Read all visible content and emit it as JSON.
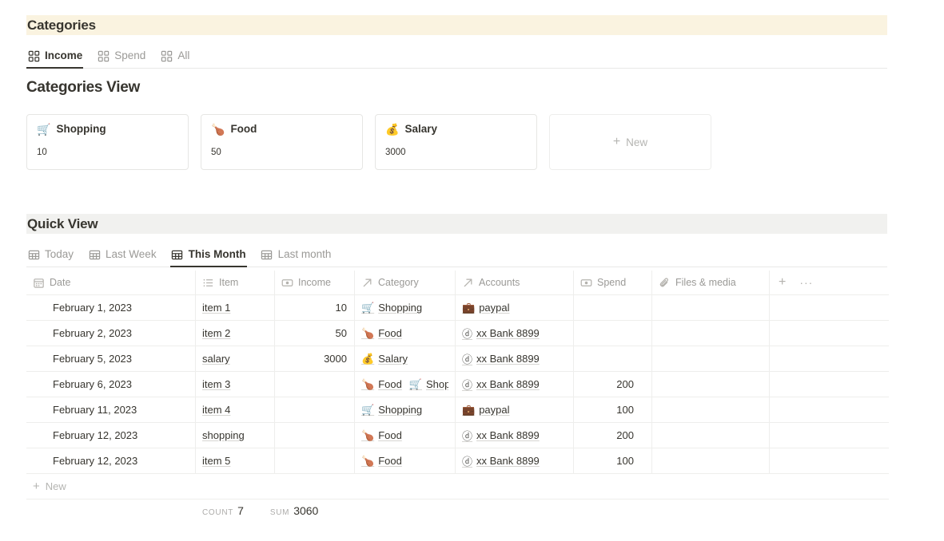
{
  "categories_section": {
    "band_title": "Categories",
    "band_color": "#faf3e0",
    "tabs": [
      {
        "label": "Income",
        "icon": "gallery-icon",
        "active": true
      },
      {
        "label": "Spend",
        "icon": "gallery-icon",
        "active": false
      },
      {
        "label": "All",
        "icon": "gallery-icon",
        "active": false
      }
    ],
    "view_title": "Categories View",
    "cards": [
      {
        "emoji": "🛒",
        "title": "Shopping",
        "value": "10"
      },
      {
        "emoji": "🍗",
        "title": "Food",
        "value": "50"
      },
      {
        "emoji": "💰",
        "title": "Salary",
        "value": "3000"
      }
    ],
    "new_card_label": "New"
  },
  "quick_view_section": {
    "band_title": "Quick View",
    "band_color": "#f1f1ef",
    "tabs": [
      {
        "label": "Today",
        "icon": "table-icon",
        "active": false
      },
      {
        "label": "Last Week",
        "icon": "table-icon",
        "active": false
      },
      {
        "label": "This Month",
        "icon": "table-icon",
        "active": true
      },
      {
        "label": "Last month",
        "icon": "table-icon",
        "active": false
      }
    ],
    "table": {
      "columns": [
        {
          "label": "Date",
          "icon": "calendar-icon"
        },
        {
          "label": "Item",
          "icon": "text-lines-icon"
        },
        {
          "label": "Income",
          "icon": "number-icon"
        },
        {
          "label": "Category",
          "icon": "relation-arrow-icon"
        },
        {
          "label": "Accounts",
          "icon": "relation-arrow-icon"
        },
        {
          "label": "Spend",
          "icon": "number-icon"
        },
        {
          "label": "Files & media",
          "icon": "paperclip-icon"
        }
      ],
      "add_column_label": "+",
      "more_options_label": "···",
      "rows": [
        {
          "date": "February 1, 2023",
          "item": "item 1",
          "income": "10",
          "category": [
            {
              "emoji": "🛒",
              "label": "Shopping"
            }
          ],
          "accounts": [
            {
              "glyph": "💼",
              "label": "paypal"
            }
          ],
          "spend": "",
          "files": ""
        },
        {
          "date": "February 2, 2023",
          "item": "item 2",
          "income": "50",
          "category": [
            {
              "emoji": "🍗",
              "label": "Food"
            }
          ],
          "accounts": [
            {
              "glyph": "ⓓ",
              "label": "xx Bank 8899"
            }
          ],
          "spend": "",
          "files": ""
        },
        {
          "date": "February 5, 2023",
          "item": "salary",
          "income": "3000",
          "category": [
            {
              "emoji": "💰",
              "label": "Salary"
            }
          ],
          "accounts": [
            {
              "glyph": "ⓓ",
              "label": "xx Bank 8899"
            }
          ],
          "spend": "",
          "files": ""
        },
        {
          "date": "February 6, 2023",
          "item": "item 3",
          "income": "",
          "category": [
            {
              "emoji": "🍗",
              "label": "Food"
            },
            {
              "emoji": "🛒",
              "label": "Shopping"
            }
          ],
          "accounts": [
            {
              "glyph": "ⓓ",
              "label": "xx Bank 8899"
            }
          ],
          "spend": "200",
          "files": ""
        },
        {
          "date": "February 11, 2023",
          "item": "item 4",
          "income": "",
          "category": [
            {
              "emoji": "🛒",
              "label": "Shopping"
            }
          ],
          "accounts": [
            {
              "glyph": "💼",
              "label": "paypal"
            }
          ],
          "spend": "100",
          "files": ""
        },
        {
          "date": "February 12, 2023",
          "item": "shopping",
          "income": "",
          "category": [
            {
              "emoji": "🍗",
              "label": "Food"
            }
          ],
          "accounts": [
            {
              "glyph": "ⓓ",
              "label": "xx Bank 8899"
            }
          ],
          "spend": "200",
          "files": ""
        },
        {
          "date": "February 12, 2023",
          "item": "item 5",
          "income": "",
          "category": [
            {
              "emoji": "🍗",
              "label": "Food"
            }
          ],
          "accounts": [
            {
              "glyph": "ⓓ",
              "label": "xx Bank 8899"
            }
          ],
          "spend": "100",
          "files": ""
        }
      ],
      "new_row_label": "New",
      "summary": {
        "count_label": "Count",
        "count_value": "7",
        "sum_label": "Sum",
        "sum_value": "3060"
      }
    }
  }
}
